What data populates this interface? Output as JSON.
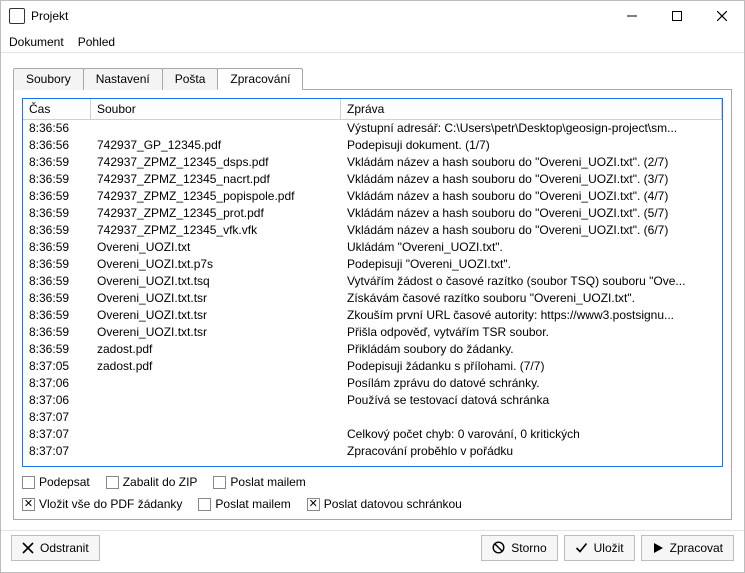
{
  "window": {
    "title": "Projekt"
  },
  "menu": {
    "dokument": "Dokument",
    "pohled": "Pohled"
  },
  "tabs": {
    "soubory": "Soubory",
    "nastaveni": "Nastavení",
    "posta": "Pošta",
    "zpracovani": "Zpracování"
  },
  "cols": {
    "cas": "Čas",
    "soubor": "Soubor",
    "zprava": "Zpráva"
  },
  "rows": [
    {
      "t": "8:36:56",
      "f": "",
      "m": "Výstupní adresář: C:\\Users\\petr\\Desktop\\geosign-project\\sm..."
    },
    {
      "t": "8:36:56",
      "f": "742937_GP_12345.pdf",
      "m": "Podepisuji dokument. (1/7)"
    },
    {
      "t": "8:36:59",
      "f": "742937_ZPMZ_12345_dsps.pdf",
      "m": "Vkládám název a hash souboru do \"Overeni_UOZI.txt\". (2/7)"
    },
    {
      "t": "8:36:59",
      "f": "742937_ZPMZ_12345_nacrt.pdf",
      "m": "Vkládám název a hash souboru do \"Overeni_UOZI.txt\". (3/7)"
    },
    {
      "t": "8:36:59",
      "f": "742937_ZPMZ_12345_popispole.pdf",
      "m": "Vkládám název a hash souboru do \"Overeni_UOZI.txt\". (4/7)"
    },
    {
      "t": "8:36:59",
      "f": "742937_ZPMZ_12345_prot.pdf",
      "m": "Vkládám název a hash souboru do \"Overeni_UOZI.txt\". (5/7)"
    },
    {
      "t": "8:36:59",
      "f": "742937_ZPMZ_12345_vfk.vfk",
      "m": "Vkládám název a hash souboru do \"Overeni_UOZI.txt\". (6/7)"
    },
    {
      "t": "8:36:59",
      "f": "Overeni_UOZI.txt",
      "m": "Ukládám \"Overeni_UOZI.txt\"."
    },
    {
      "t": "8:36:59",
      "f": "Overeni_UOZI.txt.p7s",
      "m": "Podepisuji \"Overeni_UOZI.txt\"."
    },
    {
      "t": "8:36:59",
      "f": "Overeni_UOZI.txt.tsq",
      "m": "Vytvářím žádost o časové razítko (soubor TSQ) souboru \"Ove..."
    },
    {
      "t": "8:36:59",
      "f": "Overeni_UOZI.txt.tsr",
      "m": "Získávám časové razítko souboru \"Overeni_UOZI.txt\"."
    },
    {
      "t": "8:36:59",
      "f": "Overeni_UOZI.txt.tsr",
      "m": "Zkouším první URL časové autority: https://www3.postsignu..."
    },
    {
      "t": "8:36:59",
      "f": "Overeni_UOZI.txt.tsr",
      "m": "Přišla odpověď, vytvářím TSR soubor."
    },
    {
      "t": "8:36:59",
      "f": "zadost.pdf",
      "m": "Přikládám soubory do žádanky."
    },
    {
      "t": "8:37:05",
      "f": "zadost.pdf",
      "m": "Podepisuji žádanku s přílohami. (7/7)"
    },
    {
      "t": "8:37:06",
      "f": "",
      "m": "Posílám zprávu do datové schránky."
    },
    {
      "t": "8:37:06",
      "f": "",
      "m": "Používá se testovací datová schránka"
    },
    {
      "t": "8:37:07",
      "f": "",
      "m": ""
    },
    {
      "t": "8:37:07",
      "f": "",
      "m": "Celkový počet chyb: 0 varování, 0 kritických"
    },
    {
      "t": "8:37:07",
      "f": "",
      "m": "Zpracování proběhlo v pořádku"
    }
  ],
  "opts": {
    "podepsat": "Podepsat",
    "zabalit": "Zabalit do ZIP",
    "mail1": "Poslat mailem",
    "vlozit": "Vložit vše do PDF žádanky",
    "mail2": "Poslat mailem",
    "datova": "Poslat datovou schránkou"
  },
  "buttons": {
    "odstranit": "Odstranit",
    "storno": "Storno",
    "ulozit": "Uložit",
    "zpracovat": "Zpracovat"
  }
}
